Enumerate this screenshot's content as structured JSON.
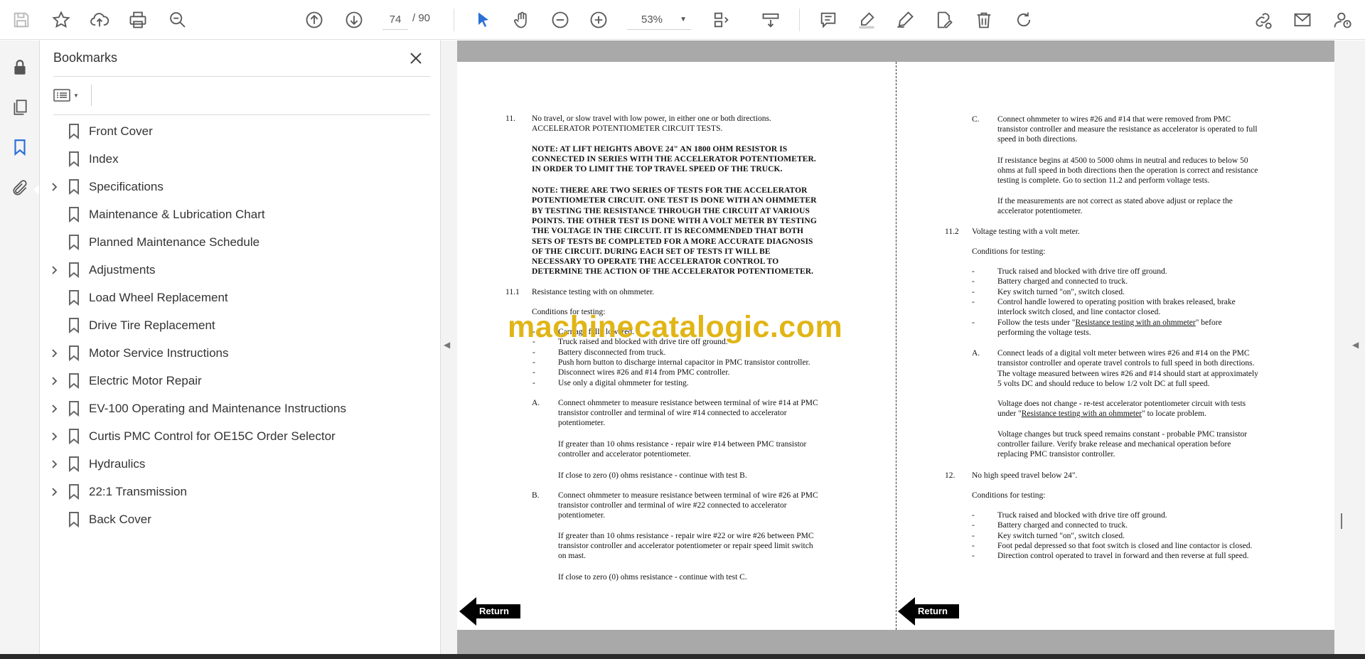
{
  "toolbar": {
    "current_page": "74",
    "total_pages": "/ 90",
    "zoom": "53%"
  },
  "panel": {
    "title": "Bookmarks",
    "bookmarks": [
      {
        "label": "Front Cover",
        "expandable": false
      },
      {
        "label": "Index",
        "expandable": false
      },
      {
        "label": "Specifications",
        "expandable": true
      },
      {
        "label": "Maintenance & Lubrication Chart",
        "expandable": false
      },
      {
        "label": "Planned Maintenance Schedule",
        "expandable": false
      },
      {
        "label": "Adjustments",
        "expandable": true
      },
      {
        "label": "Load Wheel Replacement",
        "expandable": false
      },
      {
        "label": "Drive Tire Replacement",
        "expandable": false
      },
      {
        "label": "Motor Service Instructions",
        "expandable": true
      },
      {
        "label": "Electric Motor Repair",
        "expandable": true
      },
      {
        "label": "EV-100 Operating and Maintenance Instructions",
        "expandable": true
      },
      {
        "label": "Curtis PMC Control for OE15C Order Selector",
        "expandable": true
      },
      {
        "label": "Hydraulics",
        "expandable": true
      },
      {
        "label": "22:1 Transmission",
        "expandable": true
      },
      {
        "label": "Back Cover",
        "expandable": false
      }
    ]
  },
  "watermark": "machinecatalogic.com",
  "doc": {
    "return_label": "Return",
    "left": {
      "s11_num": "11.",
      "s11_l1": "No travel, or slow travel with low power, in either one or both directions.",
      "s11_l2": "ACCELERATOR POTENTIOMETER CIRCUIT TESTS.",
      "note1": [
        "NOTE: AT LIFT HEIGHTS ABOVE 24\" AN 1800 OHM RESISTOR IS",
        "CONNECTED IN SERIES WITH THE ACCELERATOR POTENTIOMETER.",
        "IN ORDER TO LIMIT THE TOP TRAVEL SPEED OF THE TRUCK."
      ],
      "note2": [
        "NOTE: THERE ARE TWO SERIES OF TESTS FOR THE ACCELERATOR",
        "POTENTIOMETER CIRCUIT.  ONE TEST IS DONE WITH AN OHMMETER",
        "BY TESTING THE RESISTANCE THROUGH THE CIRCUIT AT VARIOUS",
        "POINTS.  THE OTHER TEST IS DONE WITH A VOLT METER BY TESTING",
        "THE VOLTAGE IN THE CIRCUIT.  IT IS RECOMMENDED THAT BOTH",
        "SETS OF TESTS BE COMPLETED FOR A MORE ACCURATE DIAGNOSIS",
        "OF THE CIRCUIT.  DURING EACH SET OF TESTS IT WILL BE",
        "NECESSARY TO OPERATE THE ACCELERATOR CONTROL TO",
        "DETERMINE THE ACTION OF THE ACCELERATOR POTENTIOMETER."
      ],
      "s111_num": "11.1",
      "s111_title": "Resistance testing with on ohmmeter.",
      "conditions": "Conditions for testing:",
      "bullets": [
        "Carriage fully lowered.",
        "Truck raised and blocked with drive tire off ground.",
        "Battery disconnected from truck.",
        "Push horn button to discharge internal capacitor in PMC transistor controller.",
        "Disconnect wires #26 and #14 from PMC controller.",
        "Use only a digital ohmmeter for testing."
      ],
      "A_letter": "A.",
      "A_lines": [
        "Connect ohmmeter to measure resistance between terminal of wire #14 at PMC",
        "transistor controller and terminal of wire #14 connected to accelerator",
        "potentiometer."
      ],
      "A_p2": [
        "If greater than 10 ohms resistance - repair wire #14 between PMC transistor",
        "controller and accelerator potentiometer."
      ],
      "A_p3": "If close to zero (0) ohms resistance - continue with test B.",
      "B_letter": "B.",
      "B_lines": [
        "Connect ohmmeter to measure resistance between terminal of wire #26 at PMC",
        "transistor controller and terminal of wire #22 connected to accelerator",
        "potentiometer."
      ],
      "B_p2": [
        "If greater than 10 ohms resistance - repair wire #22 or wire #26 between PMC",
        "transistor controller and accelerator potentiometer or repair speed limit switch",
        "on mast."
      ],
      "B_p3": "If close to zero (0) ohms resistance - continue with test C."
    },
    "right": {
      "C_letter": "C.",
      "C_lines": [
        "Connect ohmmeter to wires #26 and #14 that were removed from PMC",
        "transistor controller and measure the resistance as accelerator is operated to full",
        "speed in both directions."
      ],
      "C_p2": [
        "If resistance begins at 4500 to 5000 ohms in neutral and reduces to below 50",
        "ohms at full speed in both directions then the operation is correct and resistance",
        "testing is complete.  Go to section 11.2 and perform voltage tests."
      ],
      "C_p3": [
        "If the measurements are not correct as stated above adjust or replace the",
        "accelerator potentiometer."
      ],
      "s112_num": "11.2",
      "s112_title": "Voltage testing with a volt meter.",
      "conditions": "Conditions for testing:",
      "bullets": [
        "Truck raised and blocked with drive tire off ground.",
        "Battery charged and connected to truck.",
        "Key switch turned \"on\", switch closed.",
        "Control handle lowered to operating position with brakes released, brake",
        "interlock switch closed, and line contactor closed.",
        "Follow the tests under \"",
        "Resistance testing with an ohmmeter",
        "\" before",
        "performing the voltage tests."
      ],
      "A_letter": "A.",
      "A_lines": [
        "Connect leads of a digital volt meter between wires #26 and #14 on the PMC",
        "transistor controller and operate travel controls to full speed in both directions.",
        "The voltage measured between wires #26 and #14 should start at approximately",
        "5 volts DC and should reduce to below 1/2 volt DC at full speed."
      ],
      "A_p2_l1": "Voltage does not change - re-test accelerator potentiometer circuit with tests",
      "A_p2_l2a": "under \"",
      "A_p2_l2b": "Resistance testing with an ohmmeter",
      "A_p2_l2c": "\" to locate problem.",
      "A_p3": [
        "Voltage changes but truck speed remains constant - probable PMC transistor",
        "controller failure.  Verify brake release and mechanical operation before",
        "replacing PMC transistor controller."
      ],
      "s12_num": "12.",
      "s12_title": "No high speed travel below 24\".",
      "conditions2": "Conditions for testing:",
      "bullets2": [
        "Truck raised and blocked with drive tire off ground.",
        "Battery charged and connected to truck.",
        "Key switch turned \"on\", switch closed.",
        "Foot pedal depressed so that foot switch is closed and line contactor is closed.",
        "Direction control operated to travel in forward and then reverse at full speed."
      ],
      "dash": "-"
    }
  }
}
